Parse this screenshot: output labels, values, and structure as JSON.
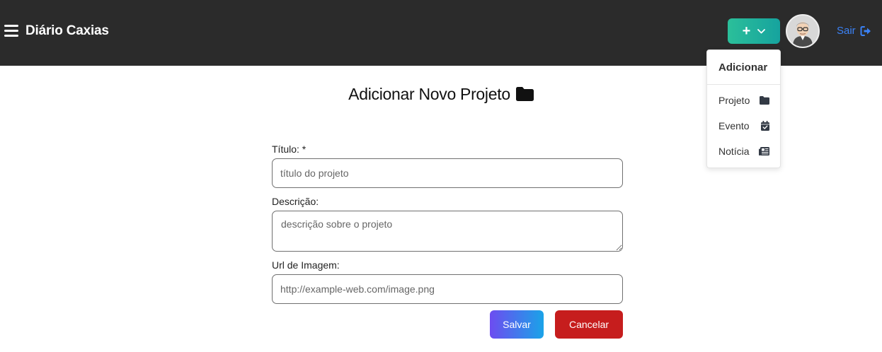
{
  "navbar": {
    "brand": "Diário Caxias",
    "add_button_icon": "plus-icon",
    "logout_label": "Sair",
    "colors": {
      "background": "#2b2b2b",
      "accent_gradient_start": "#2bbf9a",
      "accent_gradient_end": "#16a39e",
      "logout": "#3b82f6"
    }
  },
  "dropdown": {
    "title": "Adicionar",
    "items": [
      {
        "label": "Projeto",
        "icon": "folder-icon"
      },
      {
        "label": "Evento",
        "icon": "calendar-check-icon"
      },
      {
        "label": "Notícia",
        "icon": "newspaper-icon"
      }
    ]
  },
  "main": {
    "title": "Adicionar Novo Projeto",
    "form": {
      "titulo_label": "Título: *",
      "titulo_placeholder": "título do projeto",
      "descricao_label": "Descrição:",
      "descricao_placeholder": "descrição sobre o projeto",
      "url_label": "Url de Imagem:",
      "url_placeholder": "http://example-web.com/image.png",
      "save_label": "Salvar",
      "cancel_label": "Cancelar"
    }
  }
}
